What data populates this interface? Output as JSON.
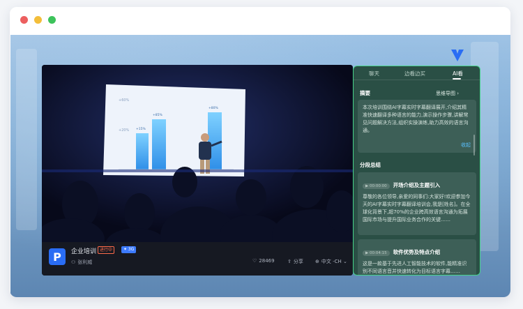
{
  "window": {
    "controls": [
      "close",
      "minimize",
      "maximize"
    ]
  },
  "video": {
    "course_title": "企业培训",
    "live_badge": "进行中",
    "ai_badge": "✦ 3G",
    "presenter": "张利威",
    "views": "28469",
    "share_label": "分享",
    "language": "中文 -CH ⌄",
    "slide_bars": [
      {
        "label": "+15%",
        "value": 0.35
      },
      {
        "label": "+85%",
        "value": 0.75
      },
      {
        "label": "+80%",
        "value": 0.9
      }
    ]
  },
  "panel": {
    "tabs": [
      {
        "label": "聊天",
        "active": false
      },
      {
        "label": "边看边买",
        "active": false
      },
      {
        "label": "AI看",
        "active": true
      }
    ],
    "summary_label": "摘要",
    "mindmap_label": "思维导图 ›",
    "summary_text": "本次培训围绕AI字幕实时字幕翻译展开,介绍其精准快速翻译多种语言的能力,演示操作步骤,讲解常见问题解决方法,组织实操演练,助力高效的语言沟通。",
    "collapse_label": "收起",
    "segments_label": "分段总结",
    "segments": [
      {
        "time": "▶ 00:00:00",
        "title": "开场介绍及主题引入",
        "body": "尊敬的各位领导,亲爱的同事们:大家好!欢迎参加今天的AI字幕实时字幕翻译培训会,我是[姓名]。在全球化背景下,超70%的企业跨高效语言沟通为拓展国际市场与提升国际业务合作的关键……"
      },
      {
        "time": "▶ 00:04:15",
        "title": "软件优势及特点介绍",
        "body": "这是一款基于先进人工智能技术的软件,能精准识别不同语言音并快速转化为目标语言字幕……"
      }
    ]
  },
  "colors": {
    "accent": "#46d38a",
    "panel_bg": "#2a4f45",
    "link": "#59c0ff",
    "brand": "#2a6df4"
  }
}
